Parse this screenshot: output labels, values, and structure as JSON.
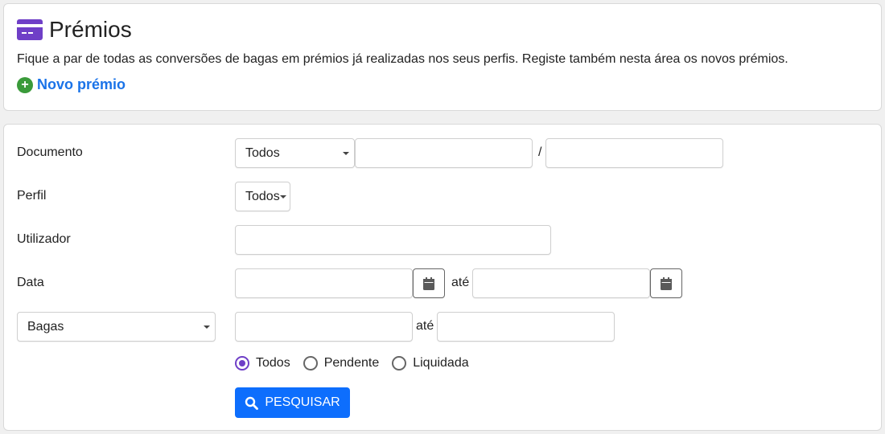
{
  "header": {
    "title": "Prémios",
    "icon": "credit-card-icon",
    "description": "Fique a par de todas as conversões de bagas em prémios já realizadas nos seus perfis. Registe também nesta área os novos prémios.",
    "new_link": "Novo prémio",
    "new_icon": "plus-circle-icon"
  },
  "form": {
    "documento": {
      "label": "Documento",
      "select_value": "Todos",
      "input1": "",
      "separator": "/",
      "input2": ""
    },
    "perfil": {
      "label": "Perfil",
      "select_value": "Todos"
    },
    "utilizador": {
      "label": "Utilizador",
      "value": ""
    },
    "data": {
      "label": "Data",
      "from": "",
      "to_label": "até",
      "to": "",
      "icon": "calendar-icon"
    },
    "bagas": {
      "select_value": "Bagas",
      "from": "",
      "to_label": "até",
      "to": ""
    },
    "status": {
      "options": [
        "Todos",
        "Pendente",
        "Liquidada"
      ],
      "selected": "Todos"
    },
    "search_button": "PESQUISAR",
    "search_icon": "search-icon"
  },
  "colors": {
    "accent": "#6f3fc7",
    "link": "#1a73e8",
    "plus": "#3a9a3a",
    "button": "#0d6efd"
  }
}
